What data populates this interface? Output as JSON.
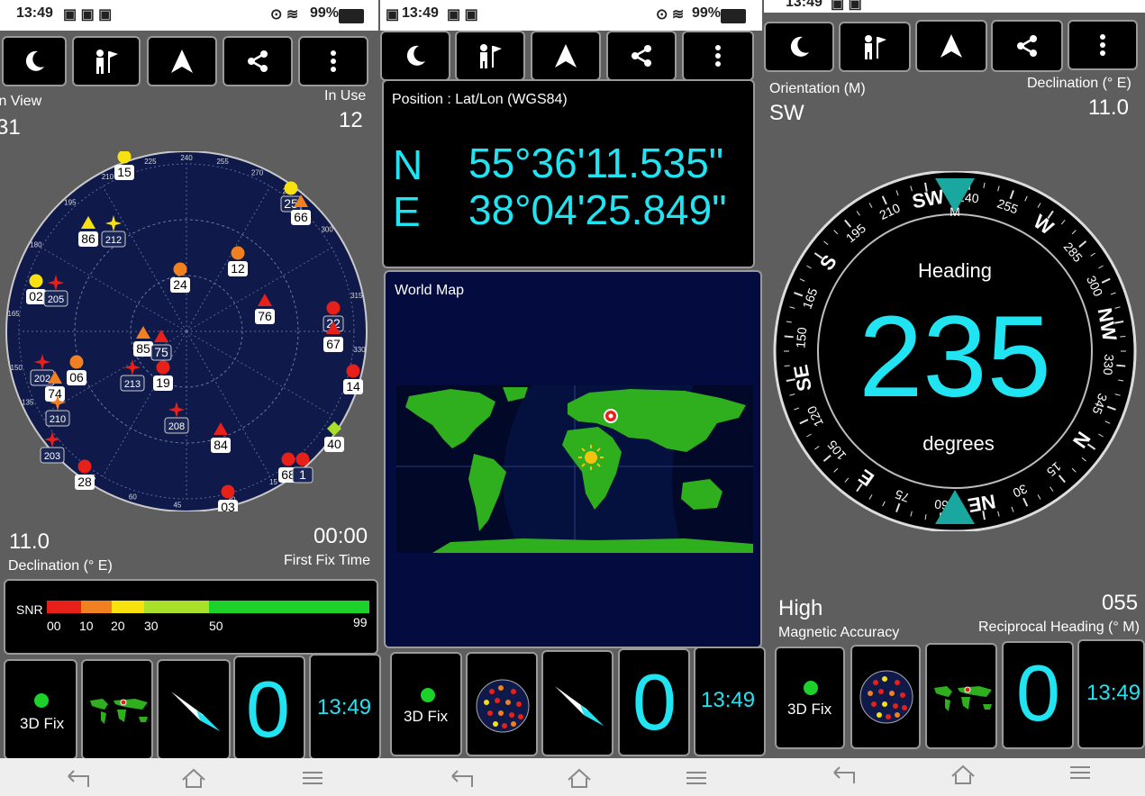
{
  "status": {
    "time": "13:49",
    "battery": "99%"
  },
  "panel1": {
    "in_view_label": "In View",
    "in_view_value": "31",
    "in_use_label": "In Use",
    "in_use_value": "12",
    "declination_value": "11.0",
    "declination_label": "Declination (° E)",
    "first_fix_value": "00:00",
    "first_fix_label": "First Fix Time",
    "snr_label": "SNR",
    "snr_ticks": [
      "00",
      "10",
      "20",
      "30",
      "50",
      "99"
    ],
    "sky_ring_labels": [
      "225",
      "240",
      "255",
      "270",
      "285",
      "300",
      "315",
      "330",
      "345",
      "15",
      "30",
      "45",
      "60",
      "75",
      "135",
      "150",
      "165",
      "180",
      "195",
      "210"
    ],
    "satellites": [
      {
        "id": "15",
        "color": "#f7e20f",
        "shape": "circle"
      },
      {
        "id": "86",
        "color": "#f7e20f",
        "shape": "triangle"
      },
      {
        "id": "212",
        "color": "#f7e20f",
        "shape": "star"
      },
      {
        "id": "02",
        "color": "#f7e20f",
        "shape": "circle"
      },
      {
        "id": "205",
        "color": "#e8201a",
        "shape": "star"
      },
      {
        "id": "24",
        "color": "#f08020",
        "shape": "circle"
      },
      {
        "id": "12",
        "color": "#f08020",
        "shape": "circle"
      },
      {
        "id": "76",
        "color": "#e8201a",
        "shape": "triangle"
      },
      {
        "id": "25",
        "color": "#f7e20f",
        "shape": "circle"
      },
      {
        "id": "66",
        "color": "#f08020",
        "shape": "triangle"
      },
      {
        "id": "22",
        "color": "#e8201a",
        "shape": "circle"
      },
      {
        "id": "67",
        "color": "#e8201a",
        "shape": "triangle"
      },
      {
        "id": "85",
        "color": "#f08020",
        "shape": "triangle"
      },
      {
        "id": "75",
        "color": "#e8201a",
        "shape": "triangle"
      },
      {
        "id": "213",
        "color": "#e8201a",
        "shape": "star"
      },
      {
        "id": "19",
        "color": "#e8201a",
        "shape": "circle"
      },
      {
        "id": "06",
        "color": "#f08020",
        "shape": "circle"
      },
      {
        "id": "202",
        "color": "#e8201a",
        "shape": "star"
      },
      {
        "id": "74",
        "color": "#f08020",
        "shape": "triangle"
      },
      {
        "id": "210",
        "color": "#f08020",
        "shape": "star"
      },
      {
        "id": "208",
        "color": "#e8201a",
        "shape": "star"
      },
      {
        "id": "84",
        "color": "#e8201a",
        "shape": "triangle"
      },
      {
        "id": "14",
        "color": "#e8201a",
        "shape": "circle"
      },
      {
        "id": "40",
        "color": "#a8e02a",
        "shape": "diamond"
      },
      {
        "id": "203",
        "color": "#e8201a",
        "shape": "star"
      },
      {
        "id": "28",
        "color": "#e8201a",
        "shape": "circle"
      },
      {
        "id": "03",
        "color": "#e8201a",
        "shape": "circle"
      },
      {
        "id": "68",
        "color": "#e8201a",
        "shape": "circle"
      },
      {
        "id": "1",
        "color": "#e8201a",
        "shape": "circle"
      }
    ],
    "tiles": {
      "fix_label": "3D Fix",
      "count_value": "0",
      "time_value": "13:49"
    }
  },
  "panel2": {
    "position_label": "Position : Lat/Lon (WGS84)",
    "lat_hemi": "N",
    "lat_value": "55°36'11.535\"",
    "lon_hemi": "E",
    "lon_value": "38°04'25.849\"",
    "map_label": "World Map",
    "tiles": {
      "fix_label": "3D Fix",
      "count_value": "0",
      "time_value": "13:49"
    }
  },
  "panel3": {
    "orientation_label": "Orientation (M)",
    "orientation_value": "SW",
    "declination_label": "Declination (° E)",
    "declination_value": "11.0",
    "heading_label": "Heading",
    "heading_value": "235",
    "heading_unit": "degrees",
    "accuracy_value": "High",
    "accuracy_label": "Magnetic Accuracy",
    "reciprocal_value": "055",
    "reciprocal_label": "Reciprocal Heading (° M)",
    "compass_labels": [
      "SW",
      "240",
      "255",
      "W",
      "285",
      "300",
      "NW",
      "330",
      "345",
      "N",
      "15",
      "30",
      "NE",
      "60",
      "75",
      "E",
      "105",
      "120",
      "SE",
      "150",
      "165",
      "S",
      "195",
      "210"
    ],
    "compass_marker": "M",
    "tiles": {
      "fix_label": "3D Fix",
      "count_value": "0",
      "time_value": "13:49"
    }
  },
  "colors": {
    "accent_cyan": "#20e4f2",
    "sky_bg": "#0f1a4a",
    "map_bg": "#040b3e",
    "land": "#2fae1e",
    "fix_dot": "#1bd12a"
  }
}
